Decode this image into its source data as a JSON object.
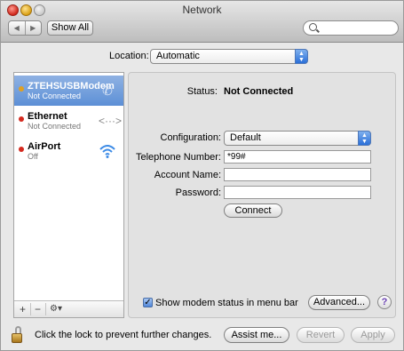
{
  "window": {
    "title": "Network"
  },
  "toolbar": {
    "back_icon": "◀",
    "forward_icon": "▶",
    "show_all_label": "Show All",
    "search_placeholder": ""
  },
  "location": {
    "label": "Location:",
    "value": "Automatic"
  },
  "sidebar": {
    "items": [
      {
        "name": "ZTEHSUSBModem",
        "status": "Not Connected",
        "status_color": "#d99a1e",
        "icon": "phone-handset-icon",
        "selected": true
      },
      {
        "name": "Ethernet",
        "status": "Not Connected",
        "status_color": "#d52a1f",
        "icon": "ethernet-arrows-icon",
        "selected": false
      },
      {
        "name": "AirPort",
        "status": "Off",
        "status_color": "#d52a1f",
        "icon": "wifi-icon",
        "selected": false
      }
    ],
    "add_label": "+",
    "remove_label": "−",
    "gear_label": "⚙▾"
  },
  "detail": {
    "status_label": "Status:",
    "status_value": "Not Connected",
    "configuration_label": "Configuration:",
    "configuration_value": "Default",
    "telephone_label": "Telephone Number:",
    "telephone_value": "*99#",
    "account_label": "Account Name:",
    "account_value": "",
    "password_label": "Password:",
    "password_value": "",
    "connect_label": "Connect",
    "show_modem_label": "Show modem status in menu bar",
    "show_modem_checked": true,
    "advanced_label": "Advanced...",
    "help_label": "?"
  },
  "footer": {
    "lock_text": "Click the lock to prevent further changes.",
    "assist_label": "Assist me...",
    "revert_label": "Revert",
    "apply_label": "Apply"
  }
}
